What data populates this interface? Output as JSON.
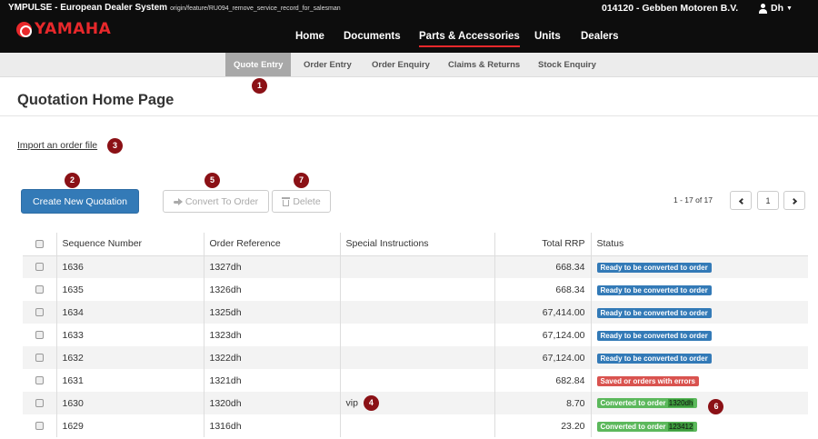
{
  "header": {
    "app_title": "YMPULSE - European Dealer System",
    "branch": "origin/feature/RU094_remove_service_record_for_salesman",
    "dealer": "014120 - Gebben Motoren B.V.",
    "user": "Dh",
    "logo_text": "YAMAHA",
    "nav": [
      "Home",
      "Documents",
      "Parts & Accessories",
      "Units",
      "Dealers"
    ],
    "active_nav": "Parts & Accessories"
  },
  "subnav": [
    "Quote Entry",
    "Order Entry",
    "Order Enquiry",
    "Claims & Returns",
    "Stock Enquiry"
  ],
  "page": {
    "title": "Quotation Home Page",
    "import_link": "Import an order file",
    "create_button": "Create New Quotation",
    "convert_button": "Convert To Order",
    "delete_button": "Delete"
  },
  "pager": {
    "range": "1 - 17 of 17",
    "page": "1"
  },
  "markers": [
    "1",
    "2",
    "3",
    "4",
    "5",
    "6",
    "7"
  ],
  "table": {
    "columns": [
      "Sequence Number",
      "Order Reference",
      "Special Instructions",
      "Total RRP",
      "Status"
    ],
    "rows": [
      {
        "seq": "1636",
        "ref": "1327dh",
        "instructions": "",
        "rrp": "668.34",
        "status": "Ready to be converted to order",
        "status_ref": ""
      },
      {
        "seq": "1635",
        "ref": "1326dh",
        "instructions": "",
        "rrp": "668.34",
        "status": "Ready to be converted to order",
        "status_ref": ""
      },
      {
        "seq": "1634",
        "ref": "1325dh",
        "instructions": "",
        "rrp": "67,414.00",
        "status": "Ready to be converted to order",
        "status_ref": ""
      },
      {
        "seq": "1633",
        "ref": "1323dh",
        "instructions": "",
        "rrp": "67,124.00",
        "status": "Ready to be converted to order",
        "status_ref": ""
      },
      {
        "seq": "1632",
        "ref": "1322dh",
        "instructions": "",
        "rrp": "67,124.00",
        "status": "Ready to be converted to order",
        "status_ref": ""
      },
      {
        "seq": "1631",
        "ref": "1321dh",
        "instructions": "",
        "rrp": "682.84",
        "status": "Saved or orders with errors",
        "status_ref": ""
      },
      {
        "seq": "1630",
        "ref": "1320dh",
        "instructions": "vip",
        "rrp": "8.70",
        "status": "Converted to order",
        "status_ref": "1320dh"
      },
      {
        "seq": "1629",
        "ref": "1316dh",
        "instructions": "",
        "rrp": "23.20",
        "status": "Converted to order",
        "status_ref": "123412"
      }
    ]
  },
  "colors": {
    "topbar": "#0d0d0d",
    "brand_red": "#e8282b",
    "marker": "#8b1116",
    "primary": "#337ab7",
    "danger": "#d9534f",
    "success": "#5cb85c"
  }
}
